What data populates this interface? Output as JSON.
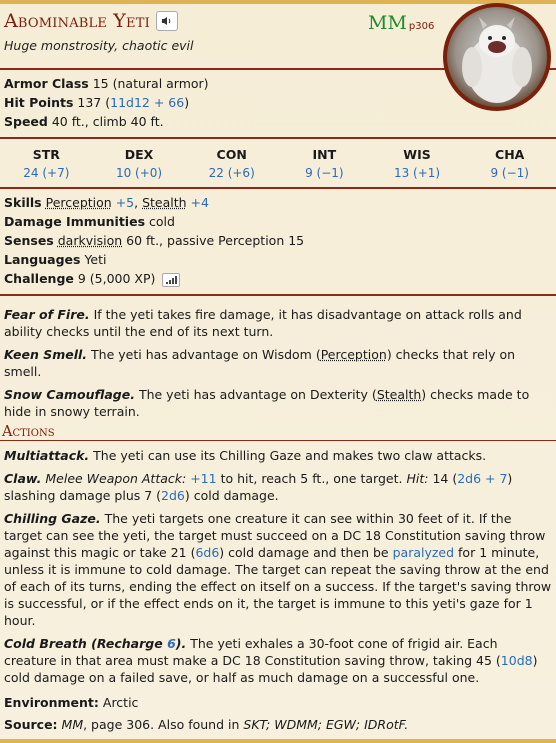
{
  "monster": {
    "name": "Abominable Yeti",
    "source_abbr": "MM",
    "source_page": "p306",
    "type_line": "Huge monstrosity, chaotic evil"
  },
  "defense": {
    "ac_label": "Armor Class",
    "ac_value": "15 (natural armor)",
    "hp_label": "Hit Points",
    "hp_value": "137",
    "hp_roll": "11d12 + 66",
    "speed_label": "Speed",
    "speed_value": "40 ft., climb 40 ft."
  },
  "abilities": [
    {
      "name": "STR",
      "value": "24 (+7)"
    },
    {
      "name": "DEX",
      "value": "10 (+0)"
    },
    {
      "name": "CON",
      "value": "22 (+6)"
    },
    {
      "name": "INT",
      "value": "9 (−1)"
    },
    {
      "name": "WIS",
      "value": "13 (+1)"
    },
    {
      "name": "CHA",
      "value": "9 (−1)"
    }
  ],
  "details": {
    "skills_label": "Skills",
    "skill1": "Perception",
    "skill1_mod": "+5",
    "skill2": "Stealth",
    "skill2_mod": "+4",
    "dmg_imm_label": "Damage Immunities",
    "dmg_imm_value": "cold",
    "senses_label": "Senses",
    "senses_dark": "darkvision",
    "senses_rest": "60 ft., passive Perception 15",
    "languages_label": "Languages",
    "languages_value": "Yeti",
    "challenge_label": "Challenge",
    "challenge_value": "9 (5,000 XP)"
  },
  "traits": [
    {
      "name": "Fear of Fire.",
      "text": "If the yeti takes fire damage, it has disadvantage on attack rolls and ability checks until the end of its next turn."
    },
    {
      "name": "Keen Smell.",
      "pre": "The yeti has advantage on Wisdom (",
      "link": "Perception",
      "post": ") checks that rely on smell."
    },
    {
      "name": "Snow Camouflage.",
      "pre": "The yeti has advantage on Dexterity (",
      "link": "Stealth",
      "post": ") checks made to hide in snowy terrain."
    }
  ],
  "actions_title": "Actions",
  "actions": {
    "multi_name": "Multiattack.",
    "multi_text": "The yeti can use its Chilling Gaze and makes two claw attacks.",
    "claw_name": "Claw.",
    "claw_type": "Melee Weapon Attack:",
    "claw_hit": "+11",
    "claw_t1": "to hit, reach 5 ft., one target.",
    "claw_hit_label": "Hit:",
    "claw_t2": "14 (",
    "claw_roll1": "2d6 + 7",
    "claw_t3": ") slashing damage plus 7 (",
    "claw_roll2": "2d6",
    "claw_t4": ") cold damage.",
    "gaze_name": "Chilling Gaze.",
    "gaze_t1": "The yeti targets one creature it can see within 30 feet of it. If the target can see the yeti, the target must succeed on a DC 18 Constitution saving throw against this magic or take 21 (",
    "gaze_roll": "6d6",
    "gaze_t2": ") cold damage and then be",
    "gaze_link": "paralyzed",
    "gaze_t3": "for 1 minute, unless it is immune to cold damage. The target can repeat the saving throw at the end of each of its turns, ending the effect on itself on a success. If the target's saving throw is successful, or if the effect ends on it, the target is immune to this yeti's gaze for 1 hour.",
    "breath_name": "Cold Breath (Recharge",
    "breath_recharge": "6",
    "breath_name_end": ").",
    "breath_t1": "The yeti exhales a 30-foot cone of frigid air. Each creature in that area must make a DC 18 Constitution saving throw, taking 45 (",
    "breath_roll": "10d8",
    "breath_t2": ") cold damage on a failed save, or half as much damage on a successful one."
  },
  "footer": {
    "env_label": "Environment:",
    "env_value": "Arctic",
    "source_label": "Source:",
    "src_book": "MM",
    "src_rest": ", page 306. Also found in",
    "also": "SKT; WDMM; EGW; IDRotF."
  },
  "colors": {
    "accent": "#7a200d",
    "roll": "#2a6bb8",
    "source": "#1f8a2e",
    "border": "#e0b253"
  }
}
